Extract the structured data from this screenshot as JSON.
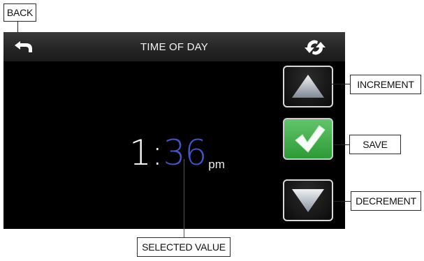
{
  "screen": {
    "title": "TIME OF DAY",
    "icons": {
      "back": "back-arrow-icon",
      "refresh": "refresh-icon"
    }
  },
  "time": {
    "hour": "1",
    "separator": ":",
    "minute": "36",
    "period": "pm"
  },
  "buttons": {
    "increment": "up-triangle-icon",
    "save": "checkmark-icon",
    "decrement": "down-triangle-icon"
  },
  "callouts": {
    "back": "BACK",
    "increment": "INCREMENT",
    "save": "SAVE",
    "decrement": "DECREMENT",
    "selected_value": "SELECTED VALUE"
  },
  "colors": {
    "selected_minute": "#3f57c9",
    "save_green": "#3aa543",
    "callout_line": "#3355aa"
  }
}
